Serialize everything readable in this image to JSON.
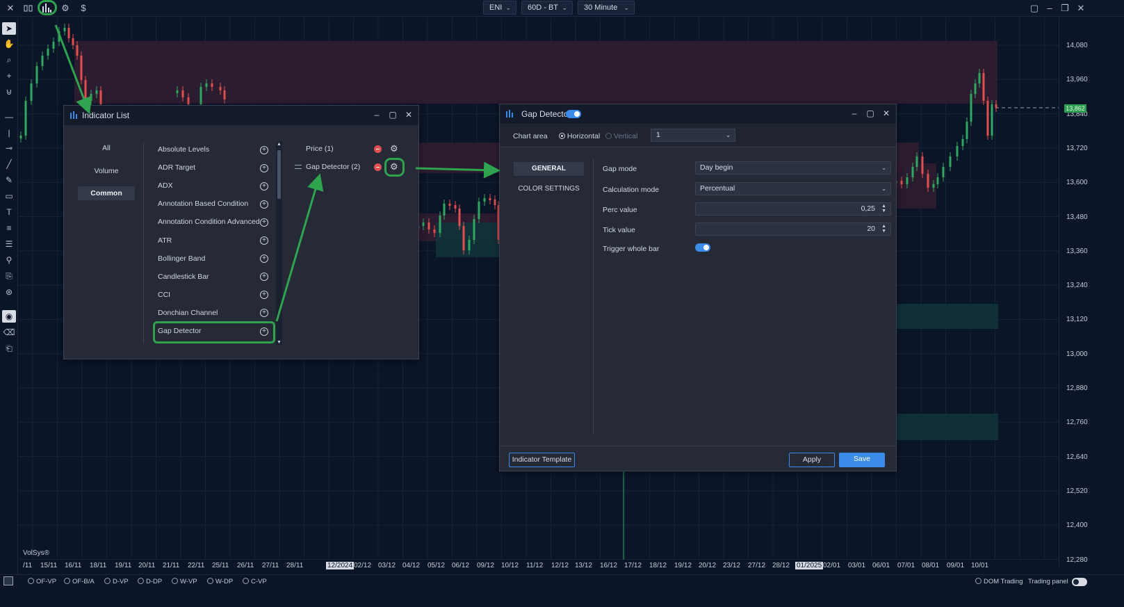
{
  "toolbar": {
    "icons": [
      "close-icon",
      "candles-icon",
      "indicators-icon",
      "settings-icon",
      "dollar-icon"
    ],
    "symbol": "ENI",
    "timeframe": "60D - BT",
    "interval": "30 Minute",
    "window_icons": [
      "layout-icon",
      "minimize-icon",
      "restore-icon",
      "close-icon"
    ]
  },
  "left_tools": [
    "pointer-icon",
    "pan-icon",
    "zoom-icon",
    "crosshair-icon",
    "magnet-icon",
    "hline-icon",
    "vline-icon",
    "ray-icon",
    "trendline-icon",
    "pencil-icon",
    "rectangle-icon",
    "text-icon",
    "list-icon",
    "fib-icon",
    "measure-icon",
    "note-icon",
    "alert-icon",
    "eye-icon",
    "eraser-icon",
    "clone-icon"
  ],
  "price_axis": [
    "14,080",
    "13,960",
    "13,840",
    "13,720",
    "13,600",
    "13,480",
    "13,360",
    "13,240",
    "13,120",
    "13,000",
    "12,880",
    "12,760",
    "12,640",
    "12,520",
    "12,400",
    "12,280"
  ],
  "current_price": "13,862",
  "time_axis": [
    "/11",
    "15/11",
    "16/11",
    "18/11",
    "19/11",
    "20/11",
    "21/11",
    "22/11",
    "25/11",
    "26/11",
    "27/11",
    "28/11",
    "12/2024",
    "02/12",
    "03/12",
    "04/12",
    "05/12",
    "06/12",
    "09/12",
    "10/12",
    "11/12",
    "12/12",
    "13/12",
    "16/12",
    "17/12",
    "18/12",
    "19/12",
    "20/12",
    "23/12",
    "27/12",
    "28/12",
    "01/2025",
    "02/01",
    "03/01",
    "06/01",
    "07/01",
    "08/01",
    "09/01",
    "10/01"
  ],
  "highlighted_dates": [
    "12/2024",
    "01/2025"
  ],
  "watermark": "VolSys®",
  "bottom_bar": {
    "profiles": [
      "OF-VP",
      "OF-B/A",
      "D-VP",
      "D-DP",
      "W-VP",
      "W-DP",
      "C-VP"
    ],
    "dom_trading": "DOM Trading",
    "trading_panel": "Trading panel"
  },
  "indicator_list": {
    "title": "Indicator List",
    "categories": [
      "All",
      "Volume",
      "Common"
    ],
    "active_category": "Common",
    "items": [
      "Absolute Levels",
      "ADR Target",
      "ADX",
      "Annotation Based Condition",
      "Annotation Condition Advanced",
      "ATR",
      "Bollinger Band",
      "Candlestick Bar",
      "CCI",
      "Donchian Channel",
      "Gap Detector"
    ],
    "active_indicators": [
      "Price (1)",
      "Gap Detector (2)"
    ]
  },
  "gap_detector": {
    "title": "Gap Detector",
    "enabled": true,
    "chart_area_label": "Chart area",
    "orientation_options": [
      "Horizontal",
      "Vertical"
    ],
    "orientation_selected": "Horizontal",
    "panel_value": "1",
    "tabs": [
      "GENERAL",
      "COLOR SETTINGS"
    ],
    "active_tab": "GENERAL",
    "fields": {
      "gap_mode_label": "Gap mode",
      "gap_mode_value": "Day begin",
      "calc_mode_label": "Calculation mode",
      "calc_mode_value": "Percentual",
      "perc_label": "Perc value",
      "perc_value": "0,25",
      "tick_label": "Tick value",
      "tick_value": "20",
      "trigger_label": "Trigger whole bar",
      "trigger_value": true
    },
    "buttons": {
      "template": "Indicator Template",
      "apply": "Apply",
      "save": "Save"
    }
  },
  "colors": {
    "background": "#0b1528",
    "up_candle": "#2fa860",
    "down_candle": "#e2504e",
    "gap_zone_red": "#3a2236",
    "gap_zone_green": "#143036",
    "accent_blue": "#3b8be8",
    "highlight_green": "#2fa34d"
  }
}
